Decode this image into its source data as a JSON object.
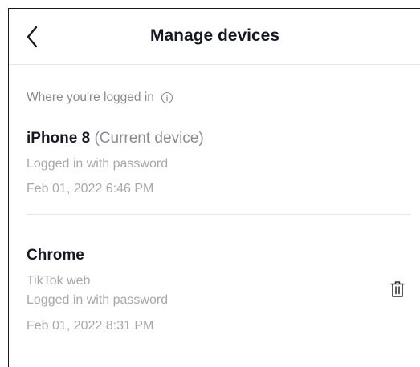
{
  "header": {
    "title": "Manage devices",
    "back_icon": "chevron-left-icon"
  },
  "section": {
    "label": "Where you're logged in",
    "info_icon": "info-icon"
  },
  "devices": [
    {
      "name": "iPhone 8",
      "tag": "(Current device)",
      "details": [
        "Logged in with password"
      ],
      "timestamp": "Feb 01, 2022 6:46 PM"
    },
    {
      "name": "Chrome",
      "details": [
        "TikTok web",
        "Logged in with password"
      ],
      "timestamp": "Feb 01, 2022 8:31 PM",
      "action_icon": "trash-icon"
    }
  ]
}
